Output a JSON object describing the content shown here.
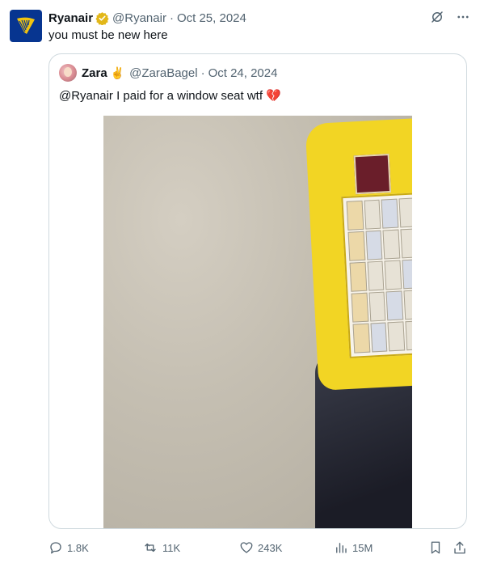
{
  "tweet": {
    "author_name": "Ryanair",
    "author_handle": "@Ryanair",
    "separator": "·",
    "date": "Oct 25, 2024",
    "text": "you must be new here"
  },
  "quote": {
    "author_name": "Zara",
    "author_emoji": "✌️",
    "author_handle": "@ZaraBagel",
    "separator": "·",
    "date": "Oct 24, 2024",
    "text": "@Ryanair I paid for a window seat wtf 💔"
  },
  "actions": {
    "replies": "1.8K",
    "reposts": "11K",
    "likes": "243K",
    "views": "15M"
  },
  "colors": {
    "brand": "#073590",
    "brand_accent": "#f1c40f",
    "text_secondary": "#536471",
    "border": "#cfd9de",
    "verified_gold": "#e2b719"
  },
  "icons": [
    "ryanair-harp-logo",
    "verified-badge-icon",
    "grok-icon",
    "more-icon",
    "reply-icon",
    "repost-icon",
    "like-icon",
    "views-icon",
    "bookmark-icon",
    "share-icon"
  ]
}
